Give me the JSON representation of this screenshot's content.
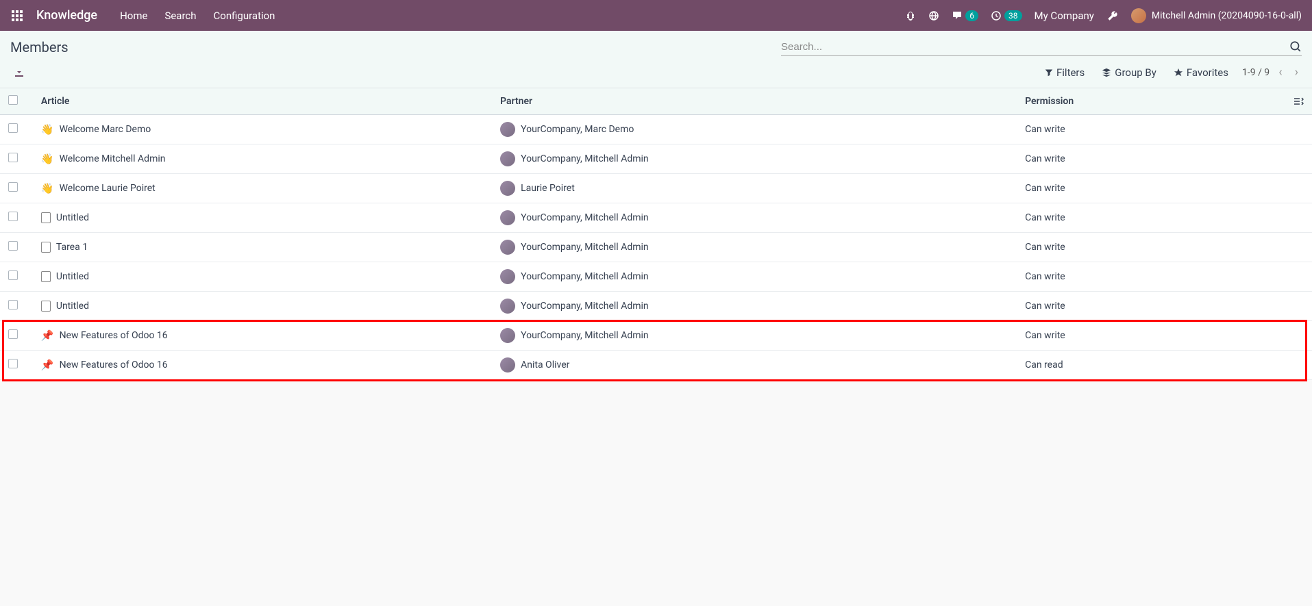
{
  "nav": {
    "brand": "Knowledge",
    "menu": [
      "Home",
      "Search",
      "Configuration"
    ],
    "messages_badge": "6",
    "activities_badge": "38",
    "company": "My Company",
    "user": "Mitchell Admin (20204090-16-0-all)"
  },
  "breadcrumb": "Members",
  "search": {
    "placeholder": "Search..."
  },
  "filters": {
    "filters": "Filters",
    "group_by": "Group By",
    "favorites": "Favorites"
  },
  "pager": "1-9 / 9",
  "columns": {
    "article": "Article",
    "partner": "Partner",
    "permission": "Permission"
  },
  "rows": [
    {
      "icon": "👋",
      "article": "Welcome Marc Demo",
      "partner": "YourCompany, Marc Demo",
      "permission": "Can write"
    },
    {
      "icon": "👋",
      "article": "Welcome Mitchell Admin",
      "partner": "YourCompany, Mitchell Admin",
      "permission": "Can write"
    },
    {
      "icon": "👋",
      "article": "Welcome Laurie Poiret",
      "partner": "Laurie Poiret",
      "permission": "Can write"
    },
    {
      "icon": "doc",
      "article": "Untitled",
      "partner": "YourCompany, Mitchell Admin",
      "permission": "Can write"
    },
    {
      "icon": "doc",
      "article": "Tarea 1",
      "partner": "YourCompany, Mitchell Admin",
      "permission": "Can write"
    },
    {
      "icon": "doc",
      "article": "Untitled",
      "partner": "YourCompany, Mitchell Admin",
      "permission": "Can write"
    },
    {
      "icon": "doc",
      "article": "Untitled",
      "partner": "YourCompany, Mitchell Admin",
      "permission": "Can write"
    },
    {
      "icon": "📌",
      "article": "New Features of Odoo 16",
      "partner": "YourCompany, Mitchell Admin",
      "permission": "Can write"
    },
    {
      "icon": "📌",
      "article": "New Features of Odoo 16",
      "partner": "Anita Oliver",
      "permission": "Can read"
    }
  ]
}
